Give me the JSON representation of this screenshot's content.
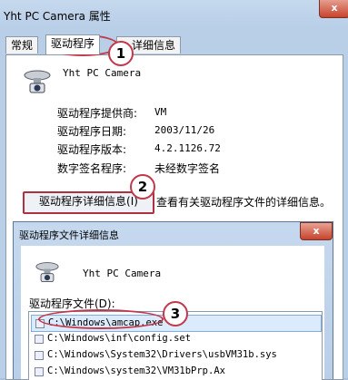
{
  "window": {
    "title": "Yht PC Camera 属性",
    "close_glyph": "x"
  },
  "tabs": [
    {
      "label": "常规"
    },
    {
      "label": "驱动程序"
    },
    {
      "label": "详细信息"
    }
  ],
  "driver": {
    "product_name": "Yht PC Camera",
    "fields": [
      {
        "label": "驱动程序提供商:",
        "value": "VM"
      },
      {
        "label": "驱动程序日期:",
        "value": "2003/11/26"
      },
      {
        "label": "驱动程序版本:",
        "value": "4.2.1126.72"
      },
      {
        "label": "数字签名程序:",
        "value": "未经数字签名"
      }
    ],
    "details_button": "驱动程序详细信息(I)",
    "details_desc": "查看有关驱动程序文件的详细信息。"
  },
  "callouts": [
    "1",
    "2",
    "3"
  ],
  "details_dialog": {
    "title": "驱动程序文件详细信息",
    "close_glyph": "x",
    "product_name": "Yht PC Camera",
    "files_label": "驱动程序文件(D):",
    "files": [
      "C:\\Windows\\amcap.exe",
      "C:\\Windows\\inf\\config.set",
      "C:\\Windows\\System32\\Drivers\\usbVM31b.sys",
      "C:\\Windows\\system32\\VM31bPrp.Ax"
    ]
  },
  "colors": {
    "accent_ring": "#c1384a",
    "titlebar": "#b9cfe8",
    "selection": "#dcebfc"
  }
}
